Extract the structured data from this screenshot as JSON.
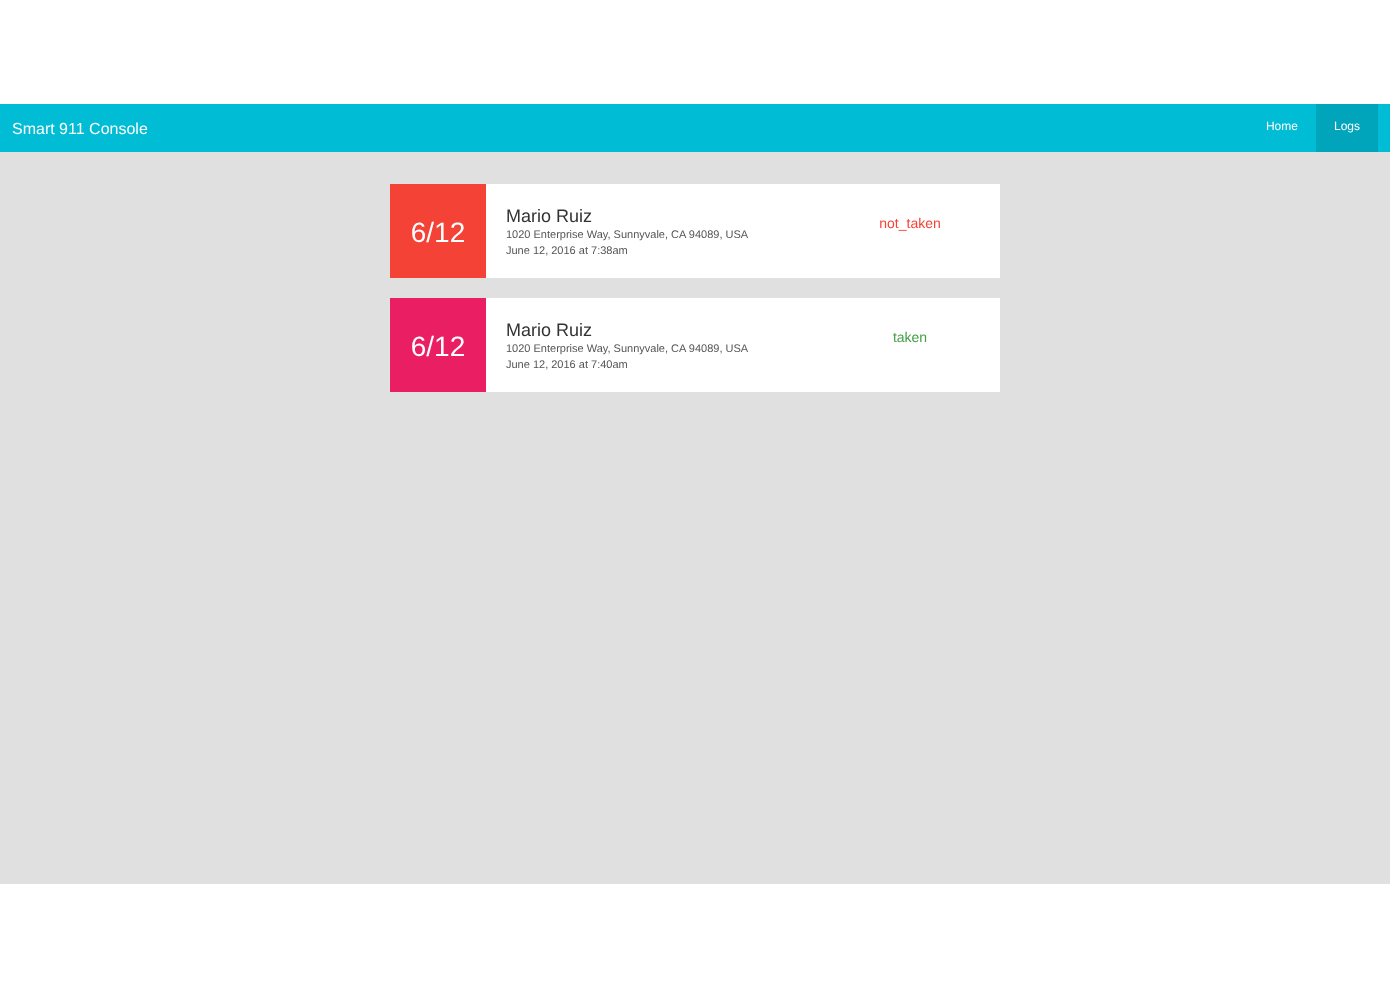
{
  "navbar": {
    "brand": "Smart 911 Console",
    "links": [
      {
        "label": "Home",
        "selected": false
      },
      {
        "label": "Logs",
        "selected": true
      }
    ]
  },
  "logs": [
    {
      "date": "6/12",
      "color": "#f44336",
      "name": "Mario Ruiz",
      "address": "1020 Enterprise Way, Sunnyvale, CA 94089, USA",
      "time": "June 12, 2016 at 7:38am",
      "status": {
        "text": "not_taken",
        "color": "#f44336"
      }
    },
    {
      "date": "6/12",
      "color": "#e91e63",
      "name": "Mario Ruiz",
      "address": "1020 Enterprise Way, Sunnyvale, CA 94089, USA",
      "time": "June 12, 2016 at 7:40am",
      "status": {
        "text": "taken",
        "color": "#43a047"
      }
    }
  ]
}
